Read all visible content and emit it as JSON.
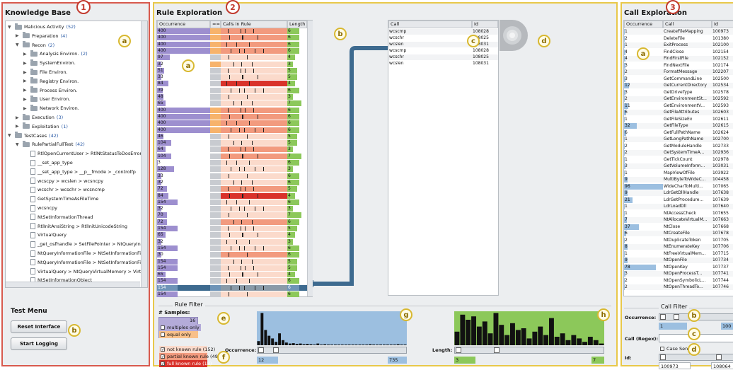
{
  "kb": {
    "title": "Knowledge Base",
    "badge": "1",
    "marker_a": "a",
    "marker_b": "b",
    "tree": [
      {
        "label": "Malicious Activity",
        "count": "(52)",
        "lvl": 0,
        "open": true,
        "kind": "folder"
      },
      {
        "label": "Preparation",
        "count": "(4)",
        "lvl": 1,
        "open": false,
        "kind": "folder"
      },
      {
        "label": "Recon",
        "count": "(2)",
        "lvl": 1,
        "open": true,
        "kind": "folder"
      },
      {
        "label": "Analysis Environ.",
        "count": "(2)",
        "lvl": 2,
        "open": false,
        "kind": "folder"
      },
      {
        "label": "SystemEnviron.",
        "count": "",
        "lvl": 2,
        "open": false,
        "kind": "folder"
      },
      {
        "label": "File Environ.",
        "count": "",
        "lvl": 2,
        "open": false,
        "kind": "folder"
      },
      {
        "label": "Registry Environ.",
        "count": "",
        "lvl": 2,
        "open": false,
        "kind": "folder"
      },
      {
        "label": "Process Environ.",
        "count": "",
        "lvl": 2,
        "open": false,
        "kind": "folder"
      },
      {
        "label": "User Environ.",
        "count": "",
        "lvl": 2,
        "open": false,
        "kind": "folder"
      },
      {
        "label": "Network Environ.",
        "count": "",
        "lvl": 2,
        "open": false,
        "kind": "folder"
      },
      {
        "label": "Execution",
        "count": "(3)",
        "lvl": 1,
        "open": false,
        "kind": "folder"
      },
      {
        "label": "Exploitation",
        "count": "(1)",
        "lvl": 1,
        "open": false,
        "kind": "folder"
      },
      {
        "label": "TestCases",
        "count": "(42)",
        "lvl": 0,
        "open": true,
        "kind": "folder"
      },
      {
        "label": "RulePartialFullTest",
        "count": "(42)",
        "lvl": 1,
        "open": true,
        "kind": "folder"
      },
      {
        "label": "RtlOpenCurrentUser > RtlNtStatusToDosError",
        "count": "",
        "lvl": 2,
        "kind": "file"
      },
      {
        "label": "__set_app_type",
        "count": "",
        "lvl": 2,
        "kind": "file"
      },
      {
        "label": "__set_app_type > __p__fmode > _controlfp",
        "count": "",
        "lvl": 2,
        "kind": "file"
      },
      {
        "label": "wcscpy > wcslen > wcsncpy",
        "count": "",
        "lvl": 2,
        "kind": "file"
      },
      {
        "label": "wcschr > wcschr > wcsncmp",
        "count": "",
        "lvl": 2,
        "kind": "file"
      },
      {
        "label": "GetSystemTimeAsFileTime",
        "count": "",
        "lvl": 2,
        "kind": "file"
      },
      {
        "label": "wcsncpy",
        "count": "",
        "lvl": 2,
        "kind": "file"
      },
      {
        "label": "NtSetInformationThread",
        "count": "",
        "lvl": 2,
        "kind": "file"
      },
      {
        "label": "RtlInitAnsiString > RtlInitUnicodeString",
        "count": "",
        "lvl": 2,
        "kind": "file"
      },
      {
        "label": "VirtualQuery",
        "count": "",
        "lvl": 2,
        "kind": "file"
      },
      {
        "label": "_get_osfhandle > SetFilePointer > NtQueryInform",
        "count": "",
        "lvl": 2,
        "kind": "file"
      },
      {
        "label": "NtQueryInformationFile > NtSetInformationFile >",
        "count": "",
        "lvl": 2,
        "kind": "file"
      },
      {
        "label": "NtQueryInformationFile > NtSetInformationFile >",
        "count": "",
        "lvl": 2,
        "kind": "file"
      },
      {
        "label": "VirtualQuery > NtQueryVirtualMemory > VirtualQu",
        "count": "",
        "lvl": 2,
        "kind": "file"
      },
      {
        "label": "NtSetInformationObject",
        "count": "",
        "lvl": 2,
        "kind": "file"
      }
    ],
    "test_menu": "Test Menu",
    "reset_label": "Reset Interface",
    "logging_label": "Start Logging"
  },
  "rules": {
    "title": "Rule Exploration",
    "badge": "2",
    "col_occ": "Occurrence",
    "col_eq": "==",
    "col_calls": "Calls in Rule",
    "col_len": "Length",
    "marker_a": "a",
    "marker_b": "b",
    "marker_c": "c",
    "marker_d": "d",
    "marker_e": "e",
    "marker_f": "f",
    "marker_g": "g",
    "marker_h": "h",
    "calls_col_call": "Call",
    "calls_col_id": "Id",
    "calls": [
      {
        "name": "wcscmp",
        "id": "108028"
      },
      {
        "name": "wcschr",
        "id": "108025"
      },
      {
        "name": "wcslen",
        "id": "108031"
      },
      {
        "name": "wcscmp",
        "id": "108028"
      },
      {
        "name": "wcschr",
        "id": "108025"
      },
      {
        "name": "wcslen",
        "id": "108031"
      }
    ],
    "rows": [
      {
        "occ": "400",
        "occ_frac": 1.0,
        "eq": "o",
        "status": "partial",
        "len": "6",
        "len_frac": 0.6
      },
      {
        "occ": "400",
        "occ_frac": 1.0,
        "eq": "o",
        "status": "partial",
        "len": "6",
        "len_frac": 0.6
      },
      {
        "occ": "400",
        "occ_frac": 1.0,
        "eq": "o",
        "status": "partial",
        "len": "6",
        "len_frac": 0.6
      },
      {
        "occ": "400",
        "occ_frac": 1.0,
        "eq": "o",
        "status": "partial",
        "len": "6",
        "len_frac": 0.6
      },
      {
        "occ": "97",
        "occ_frac": 0.24,
        "eq": "g",
        "status": "none",
        "len": "4",
        "len_frac": 0.4
      },
      {
        "occ": "32",
        "occ_frac": 0.08,
        "eq": "o",
        "status": "none",
        "len": "3",
        "len_frac": 0.3
      },
      {
        "occ": "51",
        "occ_frac": 0.13,
        "eq": "g",
        "status": "none",
        "len": "5",
        "len_frac": 0.5
      },
      {
        "occ": "33",
        "occ_frac": 0.08,
        "eq": "g",
        "status": "none",
        "len": "5",
        "len_frac": 0.5
      },
      {
        "occ": "84",
        "occ_frac": 0.21,
        "eq": "g",
        "status": "full",
        "len": "4",
        "len_frac": 0.4
      },
      {
        "occ": "39",
        "occ_frac": 0.1,
        "eq": "g",
        "status": "none",
        "len": "6",
        "len_frac": 0.6
      },
      {
        "occ": "48",
        "occ_frac": 0.12,
        "eq": "g",
        "status": "none",
        "len": "3",
        "len_frac": 0.3
      },
      {
        "occ": "65",
        "occ_frac": 0.16,
        "eq": "g",
        "status": "none",
        "len": "7",
        "len_frac": 0.7
      },
      {
        "occ": "400",
        "occ_frac": 1.0,
        "eq": "o",
        "status": "partial",
        "len": "6",
        "len_frac": 0.6
      },
      {
        "occ": "400",
        "occ_frac": 1.0,
        "eq": "o",
        "status": "partial",
        "len": "6",
        "len_frac": 0.6
      },
      {
        "occ": "400",
        "occ_frac": 1.0,
        "eq": "o",
        "status": "partial",
        "len": "6",
        "len_frac": 0.6
      },
      {
        "occ": "400",
        "occ_frac": 1.0,
        "eq": "o",
        "status": "partial",
        "len": "6",
        "len_frac": 0.6
      },
      {
        "occ": "46",
        "occ_frac": 0.12,
        "eq": "g",
        "status": "none",
        "len": "5",
        "len_frac": 0.5
      },
      {
        "occ": "104",
        "occ_frac": 0.26,
        "eq": "g",
        "status": "none",
        "len": "5",
        "len_frac": 0.5
      },
      {
        "occ": "64",
        "occ_frac": 0.16,
        "eq": "g",
        "status": "partial",
        "len": "3",
        "len_frac": 0.3
      },
      {
        "occ": "104",
        "occ_frac": 0.26,
        "eq": "g",
        "status": "partial",
        "len": "7",
        "len_frac": 0.7
      },
      {
        "occ": "3",
        "occ_frac": 0.01,
        "eq": "g",
        "status": "none",
        "len": "6",
        "len_frac": 0.6
      },
      {
        "occ": "128",
        "occ_frac": 0.32,
        "eq": "g",
        "status": "none",
        "len": "3",
        "len_frac": 0.3
      },
      {
        "occ": "33",
        "occ_frac": 0.08,
        "eq": "g",
        "status": "none",
        "len": "6",
        "len_frac": 0.6
      },
      {
        "occ": "32",
        "occ_frac": 0.08,
        "eq": "g",
        "status": "none",
        "len": "6",
        "len_frac": 0.6
      },
      {
        "occ": "72",
        "occ_frac": 0.18,
        "eq": "g",
        "status": "partial",
        "len": "5",
        "len_frac": 0.5
      },
      {
        "occ": "84",
        "occ_frac": 0.21,
        "eq": "g",
        "status": "full",
        "len": "4",
        "len_frac": 0.4
      },
      {
        "occ": "154",
        "occ_frac": 0.39,
        "eq": "g",
        "status": "none",
        "len": "6",
        "len_frac": 0.6
      },
      {
        "occ": "32",
        "occ_frac": 0.08,
        "eq": "g",
        "status": "none",
        "len": "3",
        "len_frac": 0.3
      },
      {
        "occ": "70",
        "occ_frac": 0.18,
        "eq": "g",
        "status": "none",
        "len": "7",
        "len_frac": 0.7
      },
      {
        "occ": "72",
        "occ_frac": 0.18,
        "eq": "g",
        "status": "partial",
        "len": "6",
        "len_frac": 0.6
      },
      {
        "occ": "154",
        "occ_frac": 0.39,
        "eq": "g",
        "status": "none",
        "len": "5",
        "len_frac": 0.5
      },
      {
        "occ": "65",
        "occ_frac": 0.16,
        "eq": "g",
        "status": "none",
        "len": "4",
        "len_frac": 0.4
      },
      {
        "occ": "32",
        "occ_frac": 0.08,
        "eq": "g",
        "status": "none",
        "len": "3",
        "len_frac": 0.3
      },
      {
        "occ": "154",
        "occ_frac": 0.39,
        "eq": "g",
        "status": "none",
        "len": "6",
        "len_frac": 0.6
      },
      {
        "occ": "30",
        "occ_frac": 0.08,
        "eq": "g",
        "status": "partial",
        "len": "6",
        "len_frac": 0.6
      },
      {
        "occ": "154",
        "occ_frac": 0.39,
        "eq": "g",
        "status": "none",
        "len": "5",
        "len_frac": 0.5
      },
      {
        "occ": "154",
        "occ_frac": 0.39,
        "eq": "g",
        "status": "none",
        "len": "5",
        "len_frac": 0.5
      },
      {
        "occ": "65",
        "occ_frac": 0.16,
        "eq": "g",
        "status": "none",
        "len": "4",
        "len_frac": 0.4
      },
      {
        "occ": "154",
        "occ_frac": 0.39,
        "eq": "g",
        "status": "none",
        "len": "6",
        "len_frac": 0.6
      },
      {
        "occ": "154",
        "occ_frac": 0.39,
        "eq": "g",
        "status": "selected",
        "len": "6",
        "len_frac": 0.6
      },
      {
        "occ": "154",
        "occ_frac": 0.39,
        "eq": "g",
        "status": "none",
        "len": "6",
        "len_frac": 0.6
      }
    ],
    "filter_title": "Rule Filter",
    "samples_label": "# Samples:",
    "samples_value": "16",
    "multiples_only": "multiples only",
    "equal_only": "equal only",
    "not_known": "not known rule (152)",
    "partial_known": "partial known rule (49)",
    "full_known": "full known rule (18)",
    "occ_label": "Occurrence:",
    "occ_min": "12",
    "occ_max": "735",
    "len_label": "Length:",
    "len_min": "3",
    "len_max": "7",
    "occ_hist": [
      0.12,
      0.95,
      0.45,
      0.28,
      0.2,
      0.1,
      0.35,
      0.15,
      0.08,
      0.05,
      0.06,
      0.04,
      0.05,
      0.03,
      0.04,
      0.03,
      0.02,
      0.05,
      0.02,
      0.03,
      0.02,
      0.02,
      0.02,
      0.02,
      0.02,
      0.02,
      0.02,
      0.02,
      0.02,
      0.02,
      0.02,
      0.02,
      0.03,
      0.02,
      0.02,
      0.02,
      0.02,
      0.02,
      0.02,
      0.02,
      0.03,
      0.02,
      0.02
    ],
    "len_hist": [
      0.4,
      0.9,
      0.75,
      0.85,
      0.55,
      0.7,
      0.35,
      0.95,
      0.6,
      0.3,
      0.65,
      0.45,
      0.5,
      0.2,
      0.4,
      0.55,
      0.3,
      0.8,
      0.25,
      0.35,
      0.15,
      0.3,
      0.2,
      0.1,
      0.25,
      0.15,
      0.05
    ],
    "colors": {
      "occ_bar": "#9d8fcf",
      "partial": "#f29a7e",
      "full": "#d9322b",
      "light": "#fbdacb",
      "len_bar": "#8cc85a",
      "eq_orange": "#f7b36b",
      "eq_gray": "#c8cbd0"
    }
  },
  "calls_panel": {
    "title": "Call Exploration",
    "badge": "3",
    "marker_a": "a",
    "marker_b": "b",
    "marker_c": "c",
    "marker_d": "d",
    "col_occ": "Occurrence",
    "col_call": "Call",
    "col_id": "Id",
    "rows": [
      {
        "occ": "1",
        "name": "CreateFileMapping",
        "id": "100973"
      },
      {
        "occ": "2",
        "name": "DeleteFile",
        "id": "101380"
      },
      {
        "occ": "1",
        "name": "ExitProcess",
        "id": "102100"
      },
      {
        "occ": "4",
        "name": "FindClose",
        "id": "102154"
      },
      {
        "occ": "4",
        "name": "FindFirstFile",
        "id": "102152"
      },
      {
        "occ": "3",
        "name": "FindNextFile",
        "id": "102174"
      },
      {
        "occ": "2",
        "name": "FormatMessage",
        "id": "102207"
      },
      {
        "occ": "3",
        "name": "GetCommandLine",
        "id": "102500"
      },
      {
        "occ": "12",
        "name": "GetCurrentDirectory",
        "id": "102534"
      },
      {
        "occ": "3",
        "name": "GetDriveType",
        "id": "102578"
      },
      {
        "occ": "2",
        "name": "GetEnvironmentSt...",
        "id": "102592"
      },
      {
        "occ": "11",
        "name": "GetEnvironmentV...",
        "id": "102593"
      },
      {
        "occ": "6",
        "name": "GetFileAttributes",
        "id": "102603"
      },
      {
        "occ": "1",
        "name": "GetFileSizeEx",
        "id": "102611"
      },
      {
        "occ": "32",
        "name": "GetFileType",
        "id": "102615"
      },
      {
        "occ": "6",
        "name": "GetFullPathName",
        "id": "102624"
      },
      {
        "occ": "1",
        "name": "GetLongPathName",
        "id": "102700"
      },
      {
        "occ": "2",
        "name": "GetModuleHandle",
        "id": "102733"
      },
      {
        "occ": "2",
        "name": "GetSystemTimeA...",
        "id": "102936"
      },
      {
        "occ": "1",
        "name": "GetTickCount",
        "id": "102978"
      },
      {
        "occ": "3",
        "name": "GetVolumeInform...",
        "id": "103031"
      },
      {
        "occ": "1",
        "name": "MapViewOfFile",
        "id": "103922"
      },
      {
        "occ": "9",
        "name": "MultiByteToWideC...",
        "id": "104458"
      },
      {
        "occ": "96",
        "name": "WideCharToMulti...",
        "id": "107065"
      },
      {
        "occ": "9",
        "name": "LdrGetDllHandle",
        "id": "107638"
      },
      {
        "occ": "21",
        "name": "LdrGetProcedure...",
        "id": "107639"
      },
      {
        "occ": "1",
        "name": "LdrLoadDll",
        "id": "107640"
      },
      {
        "occ": "1",
        "name": "NtAccessCheck",
        "id": "107655"
      },
      {
        "occ": "7",
        "name": "NtAllocateVirtualM...",
        "id": "107663"
      },
      {
        "occ": "37",
        "name": "NtClose",
        "id": "107668"
      },
      {
        "occ": "6",
        "name": "NtCreateFile",
        "id": "107678"
      },
      {
        "occ": "2",
        "name": "NtDuplicateToken",
        "id": "107705"
      },
      {
        "occ": "8",
        "name": "NtEnumerateKey",
        "id": "107706"
      },
      {
        "occ": "1",
        "name": "NtFreeVirtualMem...",
        "id": "107715"
      },
      {
        "occ": "9",
        "name": "NtOpenFile",
        "id": "107734"
      },
      {
        "occ": "78",
        "name": "NtOpenKey",
        "id": "107737"
      },
      {
        "occ": "3",
        "name": "NtOpenProcessT...",
        "id": "107741"
      },
      {
        "occ": "2",
        "name": "NtOpenSymbolicL...",
        "id": "107744"
      },
      {
        "occ": "2",
        "name": "NtOpenThreadTo...",
        "id": "107746"
      }
    ],
    "occ_max_value": 96,
    "filter_title": "Call Filter",
    "occ_label": "Occurrence:",
    "occ_min": "1",
    "occ_max": "100",
    "regex_label": "Call (Regex):",
    "regex_value": "",
    "case_label": "Case Sensitive",
    "id_label": "Id:",
    "id_min": "100973",
    "id_max": "108064",
    "colors": {
      "occ_bar": "#9cbfe0"
    }
  }
}
